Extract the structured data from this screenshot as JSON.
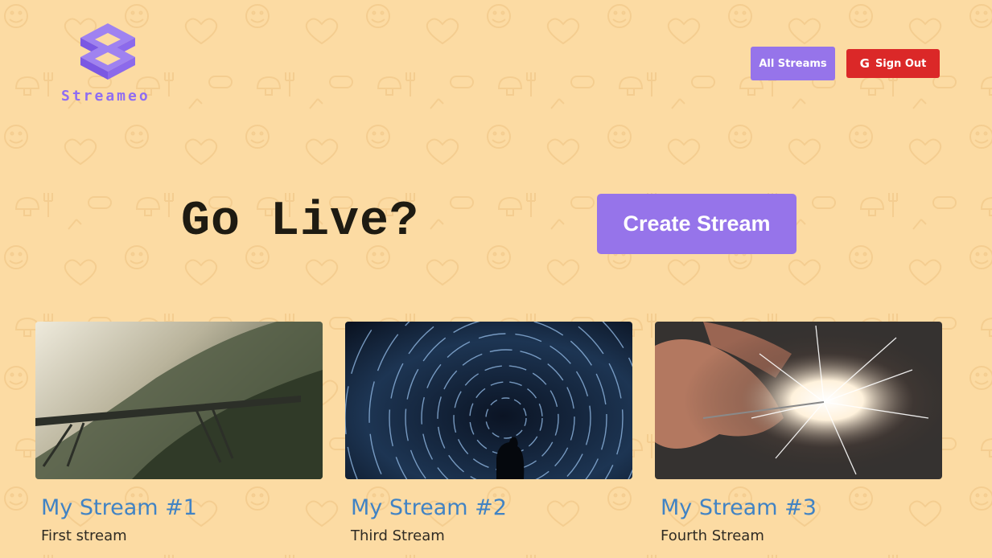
{
  "brand": {
    "name": "Streameo",
    "logo_icon": "cube-stack-icon",
    "color": "#8f6df2"
  },
  "header": {
    "all_streams_label": "All Streams",
    "sign_out_label": "Sign Out",
    "sign_out_icon": "google-icon"
  },
  "hero": {
    "title": "Go Live?",
    "create_label": "Create Stream"
  },
  "streams": [
    {
      "title": "My Stream #1",
      "description": "First stream",
      "thumbnail": "misty-mountain-bridge"
    },
    {
      "title": "My Stream #2",
      "description": "Third Stream",
      "thumbnail": "star-trails-vortex"
    },
    {
      "title": "My Stream #3",
      "description": "Fourth Stream",
      "thumbnail": "sparkler-in-hand"
    }
  ],
  "colors": {
    "background": "#fcdba3",
    "accent": "#9674ea",
    "danger": "#db2828",
    "link": "#4183c4"
  }
}
